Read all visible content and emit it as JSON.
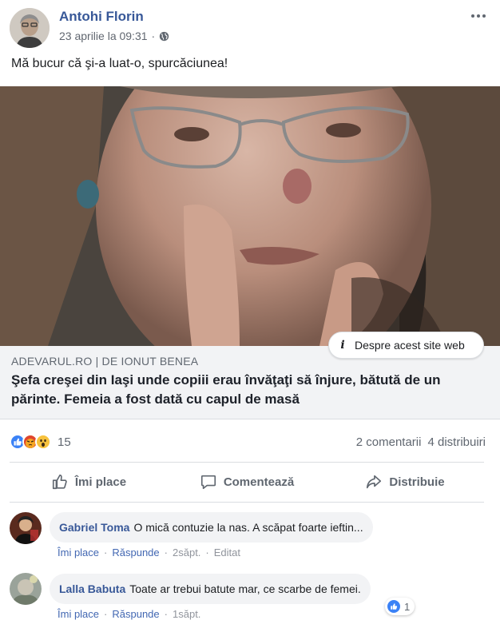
{
  "post": {
    "author": "Antohi Florin",
    "timestamp": "23 aprilie la 09:31",
    "separator": "·",
    "audience_icon": "globe-icon",
    "text": "Mă bucur că şi-a luat-o, spurcăciunea!"
  },
  "link_card": {
    "source": "ADEVARUL.RO | DE IONUT BENEA",
    "title": "Şefa creşei din Iaşi unde copiii erau învăţaţi să înjure, bătută de un părinte. Femeia a fost dată cu capul de masă",
    "info_icon": "i",
    "info_button": "Despre acest site web"
  },
  "stats": {
    "reaction_icons": [
      "like-reaction-icon",
      "angry-reaction-icon",
      "wow-reaction-icon"
    ],
    "reactions_count": "15",
    "comments": "2 comentarii",
    "shares": "4 distribuiri"
  },
  "actions": {
    "like": "Îmi place",
    "comment": "Comentează",
    "share": "Distribuie"
  },
  "comments": [
    {
      "name": "Gabriel Toma",
      "text": "O mică contuzie la nas. A scăpat foarte ieftin...",
      "like": "Îmi place",
      "reply": "Răspunde",
      "time": "2săpt.",
      "edited": "Editat"
    },
    {
      "name": "Lalla Babuta",
      "text": "Toate ar trebui batute mar, ce scarbe de femei.",
      "like": "Îmi place",
      "reply": "Răspunde",
      "time": "1săpt.",
      "reaction_count": "1"
    }
  ],
  "colors": {
    "link_blue": "#385898",
    "action_blue": "#4267b2",
    "secondary_text": "#606770",
    "card_background": "#f2f3f5",
    "divider": "#dadde1"
  }
}
